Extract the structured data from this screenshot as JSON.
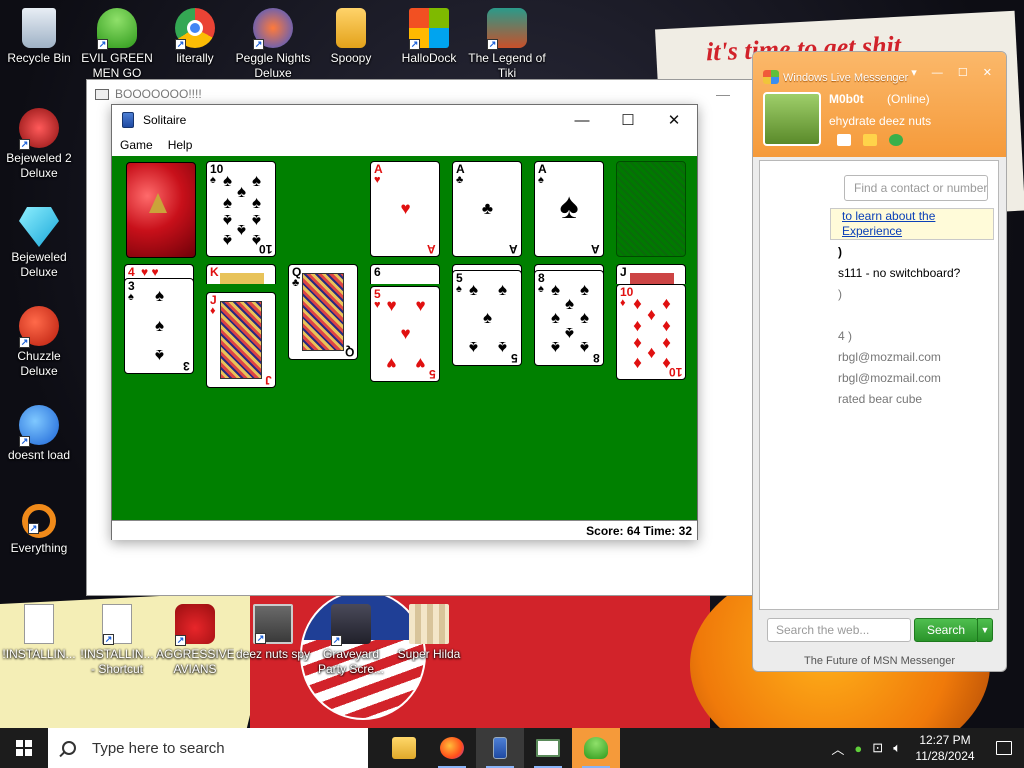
{
  "desktop": {
    "wallpaper_text": "it's time to get shit",
    "icons_left": [
      {
        "label": "Recycle Bin",
        "icon": "recycle-bin-icon"
      },
      {
        "label": "Bejeweled 2 Deluxe",
        "icon": "bejeweled-2-icon"
      },
      {
        "label": "Bejeweled Deluxe",
        "icon": "bejeweled-icon"
      },
      {
        "label": "Chuzzle Deluxe",
        "icon": "chuzzle-icon"
      },
      {
        "label": "doesnt load",
        "icon": "thunderbird-icon"
      },
      {
        "label": "Everything",
        "icon": "everything-search-icon"
      }
    ],
    "icons_top": [
      {
        "label": "EVIL GREEN MEN GO",
        "icon": "msn-buddies-icon"
      },
      {
        "label": "literally",
        "icon": "chrome-icon"
      },
      {
        "label": "Peggle Nights Deluxe",
        "icon": "peggle-icon"
      },
      {
        "label": "Spoopy",
        "icon": "folder-icon"
      },
      {
        "label": "HalloDock",
        "icon": "windows-logo-icon"
      },
      {
        "label": "The Legend of Tiki",
        "icon": "tiki-icon"
      }
    ],
    "icons_bottom": [
      {
        "label": "!INSTALLIN...",
        "icon": "document-icon"
      },
      {
        "label": "!INSTALLIN... - Shortcut",
        "icon": "document-icon"
      },
      {
        "label": "AGGRESSIVE AVIANS",
        "icon": "angry-bird-icon"
      },
      {
        "label": "deez nuts spy",
        "icon": "windows-stack-icon"
      },
      {
        "label": "Graveyard Party Scre...",
        "icon": "graveyard-icon"
      },
      {
        "label": "Super Hilda",
        "icon": "pixel-dog-icon"
      }
    ]
  },
  "boo_window": {
    "title": "BOOOOOOO!!!!",
    "minimize": "—",
    "maximize": "☐",
    "close": "✕"
  },
  "solitaire": {
    "title": "Solitaire",
    "menus": [
      "Game",
      "Help"
    ],
    "minimize": "—",
    "maximize": "☐",
    "close": "✕",
    "status": "Score: 64 Time: 32",
    "foundations": [
      {
        "rank": "A",
        "suit": "♥",
        "color": "red"
      },
      {
        "rank": "A",
        "suit": "♣",
        "color": "black"
      },
      {
        "rank": "A",
        "suit": "♠",
        "color": "black"
      }
    ],
    "waste_top": {
      "rank": "10",
      "suit": "♠",
      "color": "black"
    },
    "tableau": [
      {
        "stub": "4",
        "stub_suit": "♥",
        "top": {
          "rank": "3",
          "suit": "♠",
          "color": "black"
        }
      },
      {
        "stub": "K",
        "stub_suit": "♥",
        "top": {
          "rank": "J",
          "suit": "♦",
          "color": "red"
        }
      },
      {
        "top": {
          "rank": "Q",
          "suit": "♣",
          "color": "black"
        }
      },
      {
        "stub": "6",
        "stub_suit": "♠",
        "top": {
          "rank": "5",
          "suit": "♥",
          "color": "red"
        }
      },
      {
        "top": {
          "rank": "5",
          "suit": "♠",
          "color": "black"
        }
      },
      {
        "top": {
          "rank": "8",
          "suit": "♠",
          "color": "black"
        }
      },
      {
        "stub": "J",
        "stub_suit": "♠",
        "top": {
          "rank": "10",
          "suit": "♦",
          "color": "red"
        }
      }
    ]
  },
  "msn": {
    "brand": "Windows Live Messenger",
    "username": "M0b0t",
    "status": "(Online)",
    "personal_message": "ehydrate deez nuts",
    "find_placeholder": "Find a contact or number",
    "banner_line1": "to learn about the",
    "banner_line2": "Experience",
    "contacts": [
      ")",
      "s111 - no switchboard?",
      ")",
      "4 )",
      "rbgl@mozmail.com",
      "rbgl@mozmail.com",
      "rated bear cube"
    ],
    "search_placeholder": "Search the web...",
    "search_button": "Search",
    "footer": "The Future of MSN Messenger"
  },
  "taskbar": {
    "search_placeholder": "Type here to search",
    "apps": [
      "file-explorer-icon",
      "firefox-icon",
      "solitaire-icon",
      "window-icon",
      "msn-messenger-icon"
    ],
    "time": "12:27 PM",
    "date": "11/28/2024"
  },
  "colors": {
    "felt": "#008000",
    "msn_orange": "#f59a3a",
    "card_red": "#e01010"
  }
}
